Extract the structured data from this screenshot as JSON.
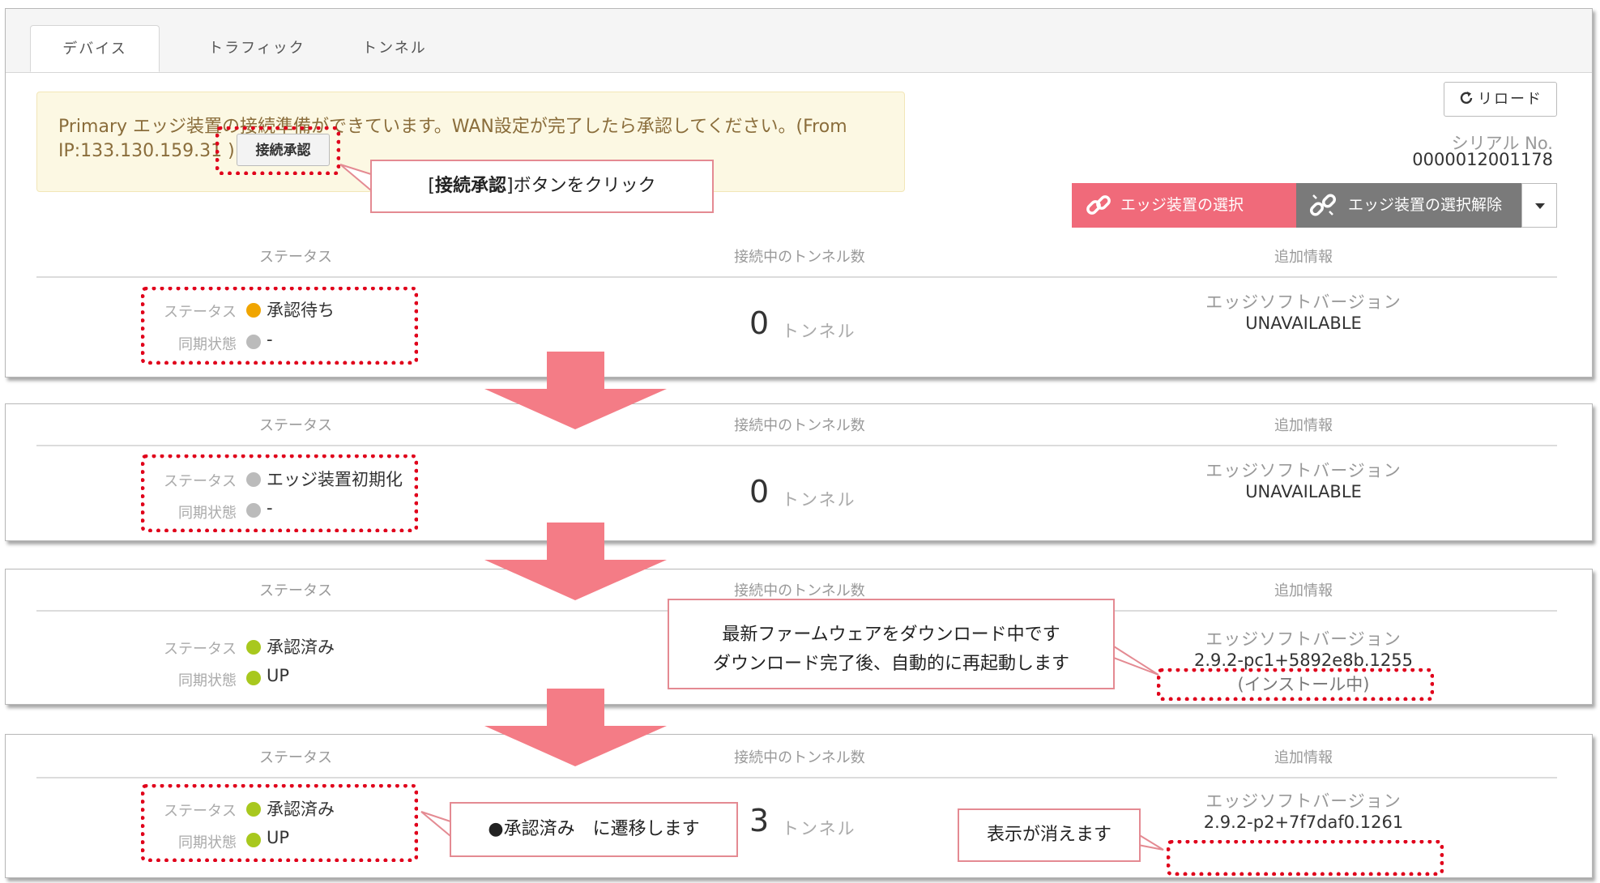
{
  "tabs": [
    {
      "label": "デバイス",
      "active": true
    },
    {
      "label": "トラフィック",
      "active": false
    },
    {
      "label": "トンネル",
      "active": false
    }
  ],
  "alert": {
    "line1": "Primary エッジ装置の接続準備ができています。WAN設定が完了したら承認してください。(From",
    "line2": "IP:133.130.159.31 )",
    "button_label": "接続承認"
  },
  "toolbar": {
    "reload_label": "リロード",
    "serial_label": "シリアル No.",
    "serial_value": "0000012001178",
    "select_label": "エッジ装置の選択",
    "deselect_label": "エッジ装置の選択解除"
  },
  "columns": {
    "status": "ステータス",
    "tunnels": "接続中のトンネル数",
    "info": "追加情報"
  },
  "labels": {
    "status_row": "ステータス",
    "sync_row": "同期状態",
    "tunnel_unit": "トンネル",
    "edge_version": "エッジソフトバージョン"
  },
  "panels": [
    {
      "status": "承認待ち",
      "status_color": "#f0a500",
      "sync": "-",
      "sync_color": "#bbbbbb",
      "tunnels": "0",
      "version": "UNAVAILABLE"
    },
    {
      "status": "エッジ装置初期化",
      "status_color": "#bbbbbb",
      "sync": "-",
      "sync_color": "#bbbbbb",
      "tunnels": "0",
      "version": "UNAVAILABLE"
    },
    {
      "status": "承認済み",
      "status_color": "#a8c81e",
      "sync": "UP",
      "sync_color": "#a8c81e",
      "tunnels": "",
      "version": "2.9.2-pc1+5892e8b.1255",
      "installing": "(インストール中)"
    },
    {
      "status": "承認済み",
      "status_color": "#a8c81e",
      "sync": "UP",
      "sync_color": "#a8c81e",
      "tunnels": "3",
      "version": "2.9.2-p2+7f7daf0.1261"
    }
  ],
  "callouts": {
    "click_prefix": "[",
    "click_bold": "接続承認",
    "click_suffix": "]ボタンをクリック",
    "firmware_line1": "最新ファームウェアをダウンロード中です",
    "firmware_line2": "ダウンロード完了後、自動的に再起動します",
    "approved": "●承認済み　に遷移します",
    "disappear": "表示が消えます"
  },
  "colors": {
    "arrow": "#f47c86",
    "dashed": "#e0001b",
    "select_btn": "#f06a7a",
    "deselect_btn": "#7a7a7a"
  }
}
